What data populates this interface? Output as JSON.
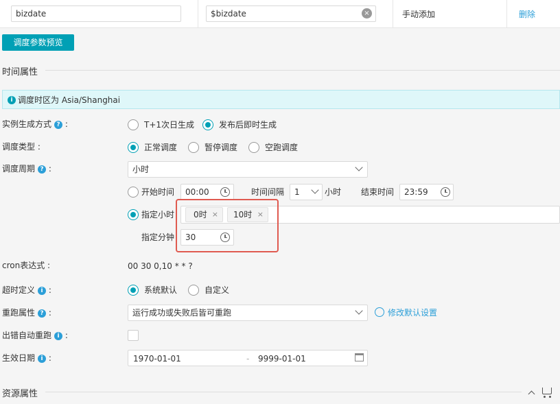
{
  "param_row": {
    "name": "bizdate",
    "value": "$bizdate",
    "source": "手动添加",
    "delete": "删除"
  },
  "preview_button": "调度参数预览",
  "time_section": {
    "title": "时间属性",
    "timezone_note": "调度时区为 Asia/Shanghai"
  },
  "instance": {
    "label": "实例生成方式",
    "options": [
      "T+1次日生成",
      "发布后即时生成"
    ],
    "selected": 1
  },
  "schedule_type": {
    "label": "调度类型",
    "options": [
      "正常调度",
      "暂停调度",
      "空跑调度"
    ],
    "selected": 0
  },
  "schedule_cycle": {
    "label": "调度周期",
    "value": "小时",
    "start_label": "开始时间",
    "start_value": "00:00",
    "interval_label": "时间间隔",
    "interval_value": "1",
    "interval_unit": "小时",
    "end_label": "结束时间",
    "end_value": "23:59",
    "specify_hour_label": "指定小时",
    "hour_tags": [
      "0时",
      "10时"
    ],
    "specify_minute_label": "指定分钟",
    "minute_value": "30"
  },
  "cron": {
    "label": "cron表达式",
    "value": "00 30 0,10 * * ?"
  },
  "timeout": {
    "label": "超时定义",
    "options": [
      "系统默认",
      "自定义"
    ],
    "selected": 0
  },
  "rerun": {
    "label": "重跑属性",
    "value": "运行成功或失败后皆可重跑",
    "link": "修改默认设置"
  },
  "auto_rerun": {
    "label": "出错自动重跑"
  },
  "effective": {
    "label": "生效日期",
    "start": "1970-01-01",
    "sep": "-",
    "end": "9999-01-01"
  },
  "resource_section": {
    "title": "资源属性"
  },
  "colors": {
    "accent": "#00a0b5",
    "help": "#2c9fd8",
    "highlight": "#e05a50"
  }
}
